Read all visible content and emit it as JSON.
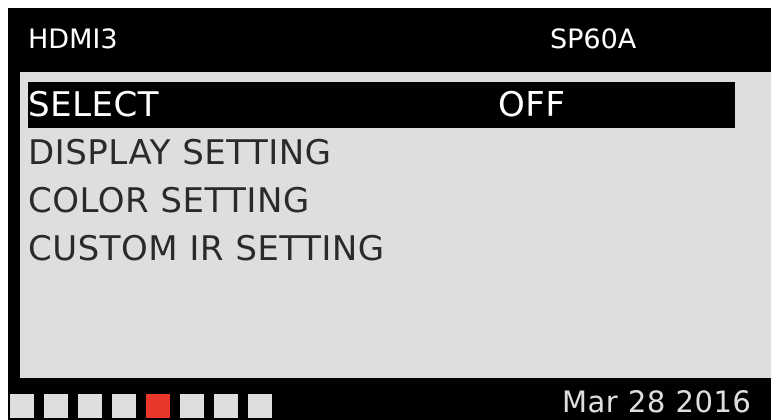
{
  "header": {
    "input_name": "HDMI3",
    "model": "SP60A"
  },
  "menu": {
    "items": [
      {
        "label": "SELECT",
        "value": "OFF",
        "selected": true
      },
      {
        "label": "DISPLAY SETTING",
        "value": "",
        "selected": false
      },
      {
        "label": "COLOR SETTING",
        "value": "",
        "selected": false
      },
      {
        "label": "CUSTOM IR SETTING",
        "value": "",
        "selected": false
      }
    ]
  },
  "footer": {
    "indicator_count": 8,
    "active_indicator": 5,
    "date": "Mar 28 2016"
  },
  "colors": {
    "background": "#000000",
    "panel": "#dedede",
    "text_dark": "#2a2a2a",
    "text_light": "#ffffff",
    "indicator_inactive": "#dedede",
    "indicator_active": "#e8372a"
  }
}
